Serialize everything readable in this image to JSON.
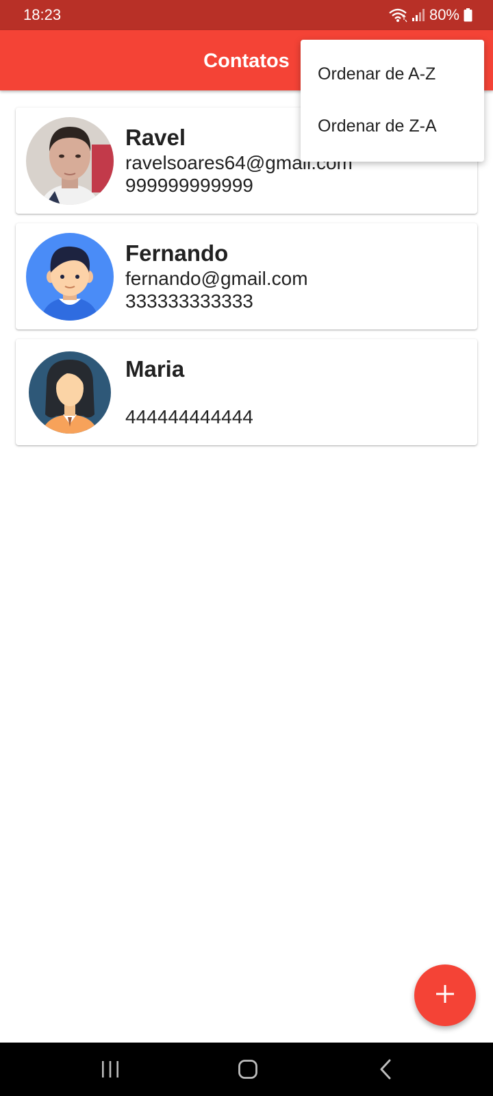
{
  "status_bar": {
    "time": "18:23",
    "battery": "80%",
    "icons": [
      "wifi-icon",
      "signal-icon",
      "battery-icon"
    ]
  },
  "app_bar": {
    "title": "Contatos"
  },
  "menu": {
    "items": [
      {
        "label": "Ordenar de A-Z"
      },
      {
        "label": "Ordenar de Z-A"
      }
    ]
  },
  "contacts": [
    {
      "name": "Ravel",
      "email": "ravelsoares64@gmail.com",
      "phone": "999999999999",
      "avatar": "photo"
    },
    {
      "name": "Fernando",
      "email": "fernando@gmail.com",
      "phone": "333333333333",
      "avatar": "male-avatar"
    },
    {
      "name": "Maria",
      "email": "",
      "phone": "444444444444",
      "avatar": "female-avatar"
    }
  ],
  "fab": {
    "icon": "plus-icon"
  },
  "nav_bar": {
    "icons": [
      "recent-apps-icon",
      "home-icon",
      "back-icon"
    ]
  },
  "colors": {
    "status_bar": "#b83027",
    "app_bar": "#f44336",
    "fab": "#f44336",
    "nav_bar": "#000000"
  }
}
